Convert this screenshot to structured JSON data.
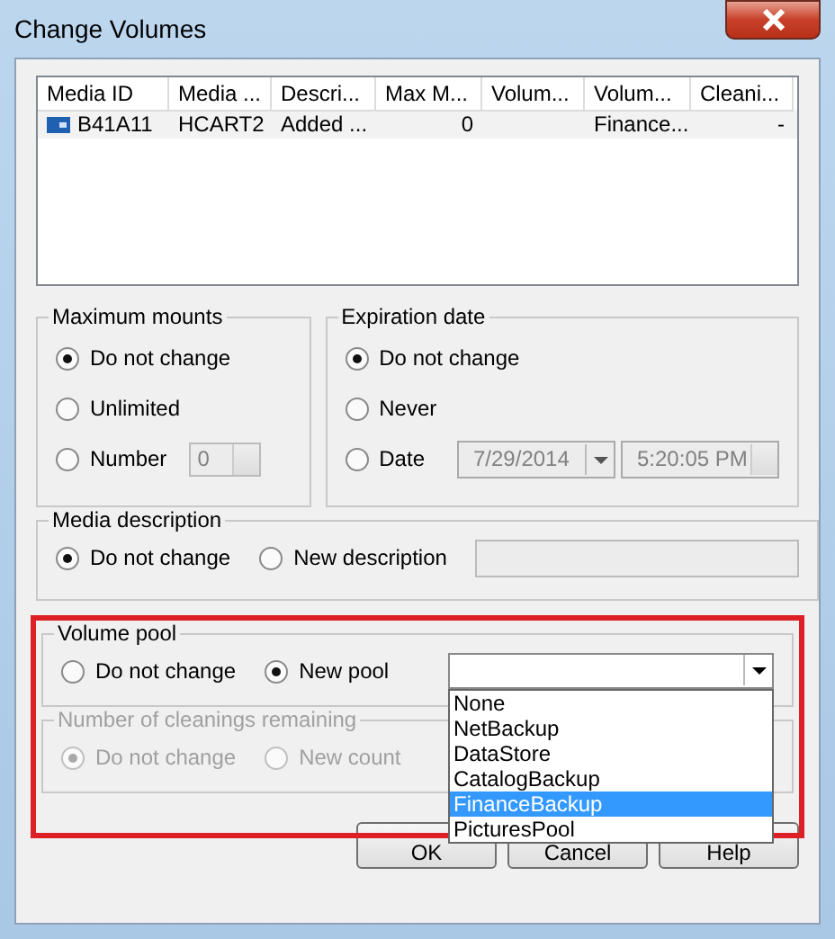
{
  "window": {
    "title": "Change Volumes"
  },
  "table": {
    "columns": [
      "Media ID",
      "Media ...",
      "Descri...",
      "Max M...",
      "Volum...",
      "Volum...",
      "Cleani..."
    ],
    "rows": [
      {
        "cells": [
          "B41A11",
          "HCART2",
          "Added ...",
          "0",
          null,
          "Finance...",
          "-"
        ]
      }
    ]
  },
  "maximum_mounts": {
    "title": "Maximum mounts",
    "options": [
      {
        "label": "Do not change",
        "selected": true
      },
      {
        "label": "Unlimited",
        "selected": false
      },
      {
        "label": "Number",
        "selected": false
      }
    ],
    "number_field": {
      "value": "0",
      "disabled": true
    }
  },
  "expiration_date": {
    "title": "Expiration date",
    "options": [
      {
        "label": "Do not change",
        "selected": true
      },
      {
        "label": "Never",
        "selected": false
      },
      {
        "label": "Date",
        "selected": false
      }
    ],
    "date_field": {
      "value": "7/29/2014",
      "disabled": true
    },
    "time_field": {
      "value": "5:20:05 PM",
      "disabled": true
    }
  },
  "media_description": {
    "title": "Media description",
    "options": [
      {
        "label": "Do not change",
        "selected": true
      },
      {
        "label": "New description",
        "selected": false
      }
    ],
    "description_field": {
      "disabled": true
    }
  },
  "volume_pool": {
    "title": "Volume pool",
    "highlighted": true,
    "options": [
      {
        "label": "Do not change",
        "selected": false
      },
      {
        "label": "New pool",
        "selected": true
      }
    ],
    "pool_dropdown": {
      "expanded": true,
      "items": [
        {
          "label": "None",
          "selected": false
        },
        {
          "label": "NetBackup",
          "selected": false
        },
        {
          "label": "DataStore",
          "selected": false
        },
        {
          "label": "CatalogBackup",
          "selected": false
        },
        {
          "label": "FinanceBackup",
          "selected": true
        },
        {
          "label": "PicturesPool",
          "selected": false
        }
      ]
    }
  },
  "cleanings": {
    "title": "Number of cleanings remaining",
    "disabled": true,
    "options": [
      {
        "label": "Do not change",
        "selected": true
      },
      {
        "label": "New count",
        "selected": false
      }
    ]
  },
  "buttons": [
    "OK",
    "Cancel",
    "Help"
  ]
}
